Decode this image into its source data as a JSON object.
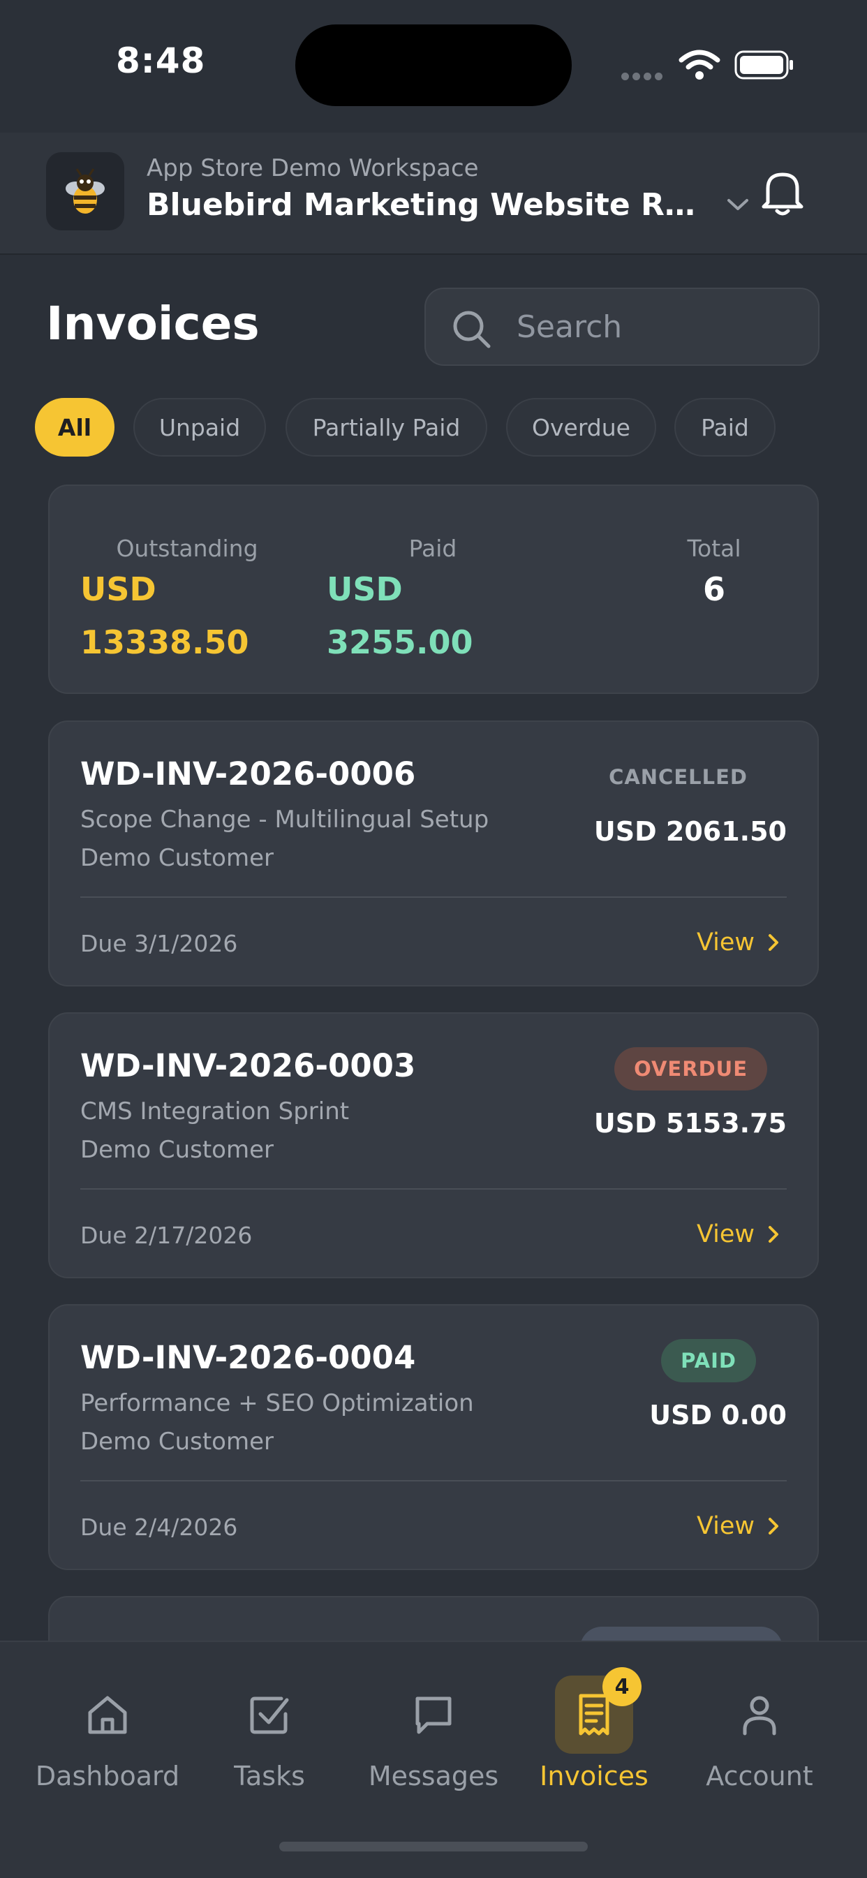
{
  "status_bar": {
    "time": "8:48"
  },
  "header": {
    "workspace": "App Store Demo Workspace",
    "project": "Bluebird Marketing Website Redesign",
    "logo_icon": "bee-icon",
    "notification_icon": "bell-icon"
  },
  "page": {
    "title": "Invoices",
    "search_placeholder": "Search"
  },
  "filters": [
    {
      "label": "All",
      "active": true
    },
    {
      "label": "Unpaid",
      "active": false
    },
    {
      "label": "Partially Paid",
      "active": false
    },
    {
      "label": "Overdue",
      "active": false
    },
    {
      "label": "Paid",
      "active": false
    }
  ],
  "summary": {
    "outstanding_label": "Outstanding",
    "outstanding_currency": "USD",
    "outstanding_value": "13338.50",
    "paid_label": "Paid",
    "paid_currency": "USD",
    "paid_value": "3255.00",
    "total_label": "Total",
    "total_value": "6"
  },
  "invoices": [
    {
      "number": "WD-INV-2026-0006",
      "title": "Scope Change - Multilingual Setup",
      "customer": "Demo Customer",
      "status": "CANCELLED",
      "amount": "USD 2061.50",
      "due": "Due 3/1/2026",
      "view_label": "View"
    },
    {
      "number": "WD-INV-2026-0003",
      "title": "CMS Integration Sprint",
      "customer": "Demo Customer",
      "status": "OVERDUE",
      "amount": "USD 5153.75",
      "due": "Due 2/17/2026",
      "view_label": "View"
    },
    {
      "number": "WD-INV-2026-0004",
      "title": "Performance + SEO Optimization",
      "customer": "Demo Customer",
      "status": "PAID",
      "amount": "USD 0.00",
      "due": "Due 2/4/2026",
      "view_label": "View"
    }
  ],
  "tabs": [
    {
      "label": "Dashboard",
      "icon": "home-icon"
    },
    {
      "label": "Tasks",
      "icon": "checkbox-icon"
    },
    {
      "label": "Messages",
      "icon": "chat-icon"
    },
    {
      "label": "Invoices",
      "icon": "invoice-icon",
      "badge": "4",
      "active": true
    },
    {
      "label": "Account",
      "icon": "user-icon"
    }
  ],
  "colors": {
    "background": "#2b3038",
    "card": "#363b44",
    "accent": "#f6c533",
    "paid_green": "#7fe0b9",
    "overdue_red": "#ef8a74"
  }
}
